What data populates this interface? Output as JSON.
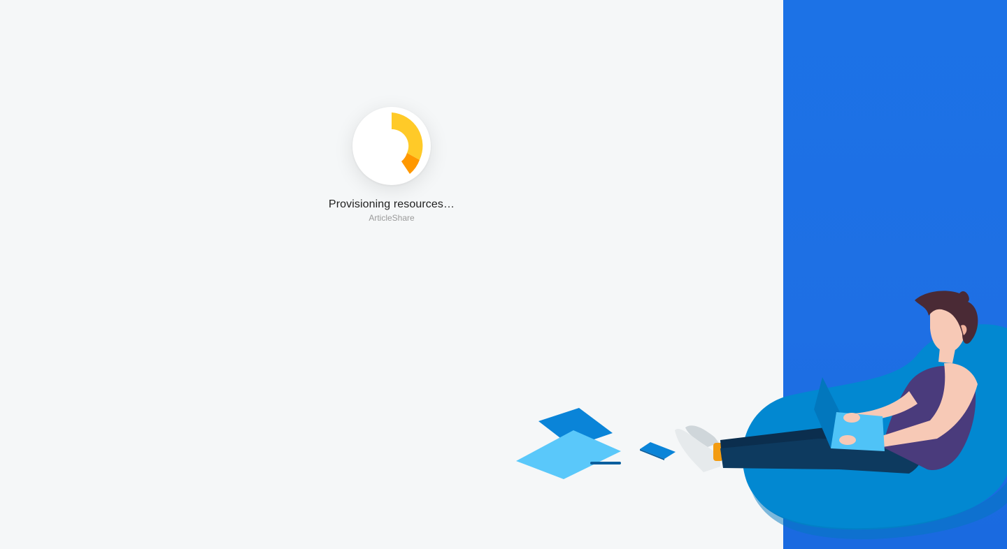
{
  "loader": {
    "status": "Provisioning resources…",
    "app_name": "ArticleShare",
    "spinner_colors": {
      "primary": "#ffca28",
      "secondary": "#ff9800"
    }
  },
  "colors": {
    "background": "#f5f7f8",
    "side_panel": "#1c72e6",
    "beanbag": "#0288d1",
    "paper_light": "#5ac8fa",
    "paper_dark": "#0a84d8"
  }
}
